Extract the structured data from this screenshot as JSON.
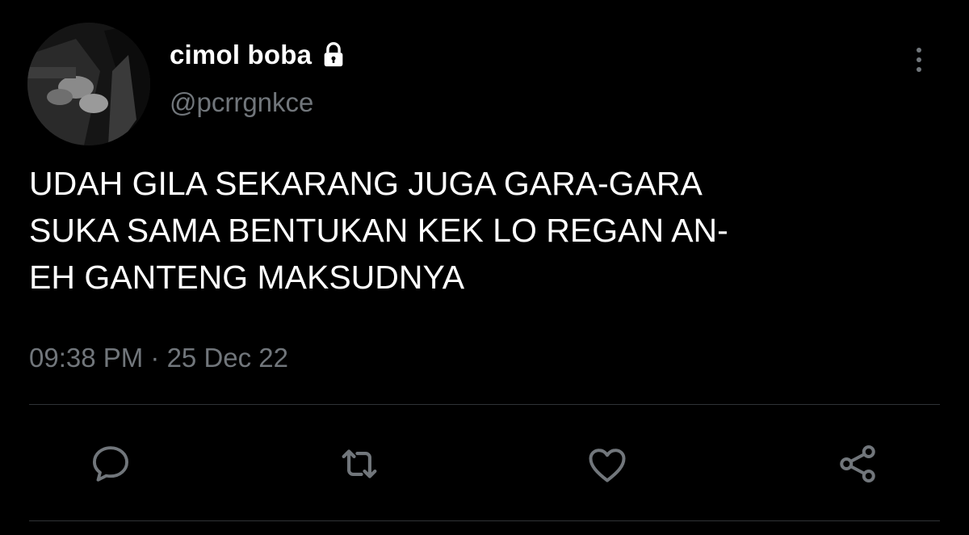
{
  "tweet": {
    "display_name": "cimol boba",
    "handle": "@pcrrgnkce",
    "text": "UDAH GILA SEKARANG JUGA GARA-GARA\nSUKA SAMA BENTUKAN KEK LO REGAN AN-\nEH GANTENG MAKSUDNYA",
    "timestamp": "09:38 PM · 25 Dec 22",
    "protected_icon": "lock-icon"
  },
  "actions": [
    {
      "name": "reply",
      "icon": "comment-icon"
    },
    {
      "name": "retweet",
      "icon": "retweet-icon"
    },
    {
      "name": "like",
      "icon": "heart-icon"
    },
    {
      "name": "share",
      "icon": "share-icon"
    }
  ],
  "colors": {
    "background": "#000000",
    "text_primary": "#ffffff",
    "text_secondary": "#71767b",
    "divider": "#2f3336",
    "icon": "#71767b"
  }
}
